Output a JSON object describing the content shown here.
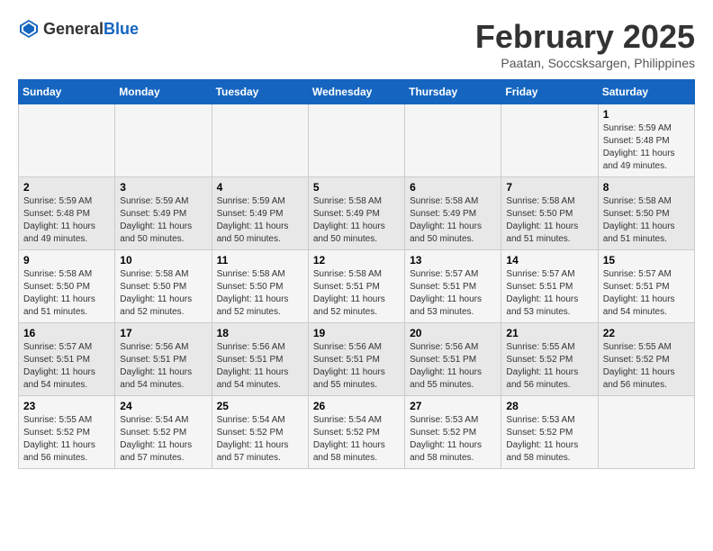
{
  "header": {
    "logo_general": "General",
    "logo_blue": "Blue",
    "month_title": "February 2025",
    "location": "Paatan, Soccsksargen, Philippines"
  },
  "weekdays": [
    "Sunday",
    "Monday",
    "Tuesday",
    "Wednesday",
    "Thursday",
    "Friday",
    "Saturday"
  ],
  "weeks": [
    [
      {
        "day": "",
        "info": ""
      },
      {
        "day": "",
        "info": ""
      },
      {
        "day": "",
        "info": ""
      },
      {
        "day": "",
        "info": ""
      },
      {
        "day": "",
        "info": ""
      },
      {
        "day": "",
        "info": ""
      },
      {
        "day": "1",
        "info": "Sunrise: 5:59 AM\nSunset: 5:48 PM\nDaylight: 11 hours and 49 minutes."
      }
    ],
    [
      {
        "day": "2",
        "info": "Sunrise: 5:59 AM\nSunset: 5:48 PM\nDaylight: 11 hours and 49 minutes."
      },
      {
        "day": "3",
        "info": "Sunrise: 5:59 AM\nSunset: 5:49 PM\nDaylight: 11 hours and 50 minutes."
      },
      {
        "day": "4",
        "info": "Sunrise: 5:59 AM\nSunset: 5:49 PM\nDaylight: 11 hours and 50 minutes."
      },
      {
        "day": "5",
        "info": "Sunrise: 5:58 AM\nSunset: 5:49 PM\nDaylight: 11 hours and 50 minutes."
      },
      {
        "day": "6",
        "info": "Sunrise: 5:58 AM\nSunset: 5:49 PM\nDaylight: 11 hours and 50 minutes."
      },
      {
        "day": "7",
        "info": "Sunrise: 5:58 AM\nSunset: 5:50 PM\nDaylight: 11 hours and 51 minutes."
      },
      {
        "day": "8",
        "info": "Sunrise: 5:58 AM\nSunset: 5:50 PM\nDaylight: 11 hours and 51 minutes."
      }
    ],
    [
      {
        "day": "9",
        "info": "Sunrise: 5:58 AM\nSunset: 5:50 PM\nDaylight: 11 hours and 51 minutes."
      },
      {
        "day": "10",
        "info": "Sunrise: 5:58 AM\nSunset: 5:50 PM\nDaylight: 11 hours and 52 minutes."
      },
      {
        "day": "11",
        "info": "Sunrise: 5:58 AM\nSunset: 5:50 PM\nDaylight: 11 hours and 52 minutes."
      },
      {
        "day": "12",
        "info": "Sunrise: 5:58 AM\nSunset: 5:51 PM\nDaylight: 11 hours and 52 minutes."
      },
      {
        "day": "13",
        "info": "Sunrise: 5:57 AM\nSunset: 5:51 PM\nDaylight: 11 hours and 53 minutes."
      },
      {
        "day": "14",
        "info": "Sunrise: 5:57 AM\nSunset: 5:51 PM\nDaylight: 11 hours and 53 minutes."
      },
      {
        "day": "15",
        "info": "Sunrise: 5:57 AM\nSunset: 5:51 PM\nDaylight: 11 hours and 54 minutes."
      }
    ],
    [
      {
        "day": "16",
        "info": "Sunrise: 5:57 AM\nSunset: 5:51 PM\nDaylight: 11 hours and 54 minutes."
      },
      {
        "day": "17",
        "info": "Sunrise: 5:56 AM\nSunset: 5:51 PM\nDaylight: 11 hours and 54 minutes."
      },
      {
        "day": "18",
        "info": "Sunrise: 5:56 AM\nSunset: 5:51 PM\nDaylight: 11 hours and 54 minutes."
      },
      {
        "day": "19",
        "info": "Sunrise: 5:56 AM\nSunset: 5:51 PM\nDaylight: 11 hours and 55 minutes."
      },
      {
        "day": "20",
        "info": "Sunrise: 5:56 AM\nSunset: 5:51 PM\nDaylight: 11 hours and 55 minutes."
      },
      {
        "day": "21",
        "info": "Sunrise: 5:55 AM\nSunset: 5:52 PM\nDaylight: 11 hours and 56 minutes."
      },
      {
        "day": "22",
        "info": "Sunrise: 5:55 AM\nSunset: 5:52 PM\nDaylight: 11 hours and 56 minutes."
      }
    ],
    [
      {
        "day": "23",
        "info": "Sunrise: 5:55 AM\nSunset: 5:52 PM\nDaylight: 11 hours and 56 minutes."
      },
      {
        "day": "24",
        "info": "Sunrise: 5:54 AM\nSunset: 5:52 PM\nDaylight: 11 hours and 57 minutes."
      },
      {
        "day": "25",
        "info": "Sunrise: 5:54 AM\nSunset: 5:52 PM\nDaylight: 11 hours and 57 minutes."
      },
      {
        "day": "26",
        "info": "Sunrise: 5:54 AM\nSunset: 5:52 PM\nDaylight: 11 hours and 58 minutes."
      },
      {
        "day": "27",
        "info": "Sunrise: 5:53 AM\nSunset: 5:52 PM\nDaylight: 11 hours and 58 minutes."
      },
      {
        "day": "28",
        "info": "Sunrise: 5:53 AM\nSunset: 5:52 PM\nDaylight: 11 hours and 58 minutes."
      },
      {
        "day": "",
        "info": ""
      }
    ]
  ]
}
